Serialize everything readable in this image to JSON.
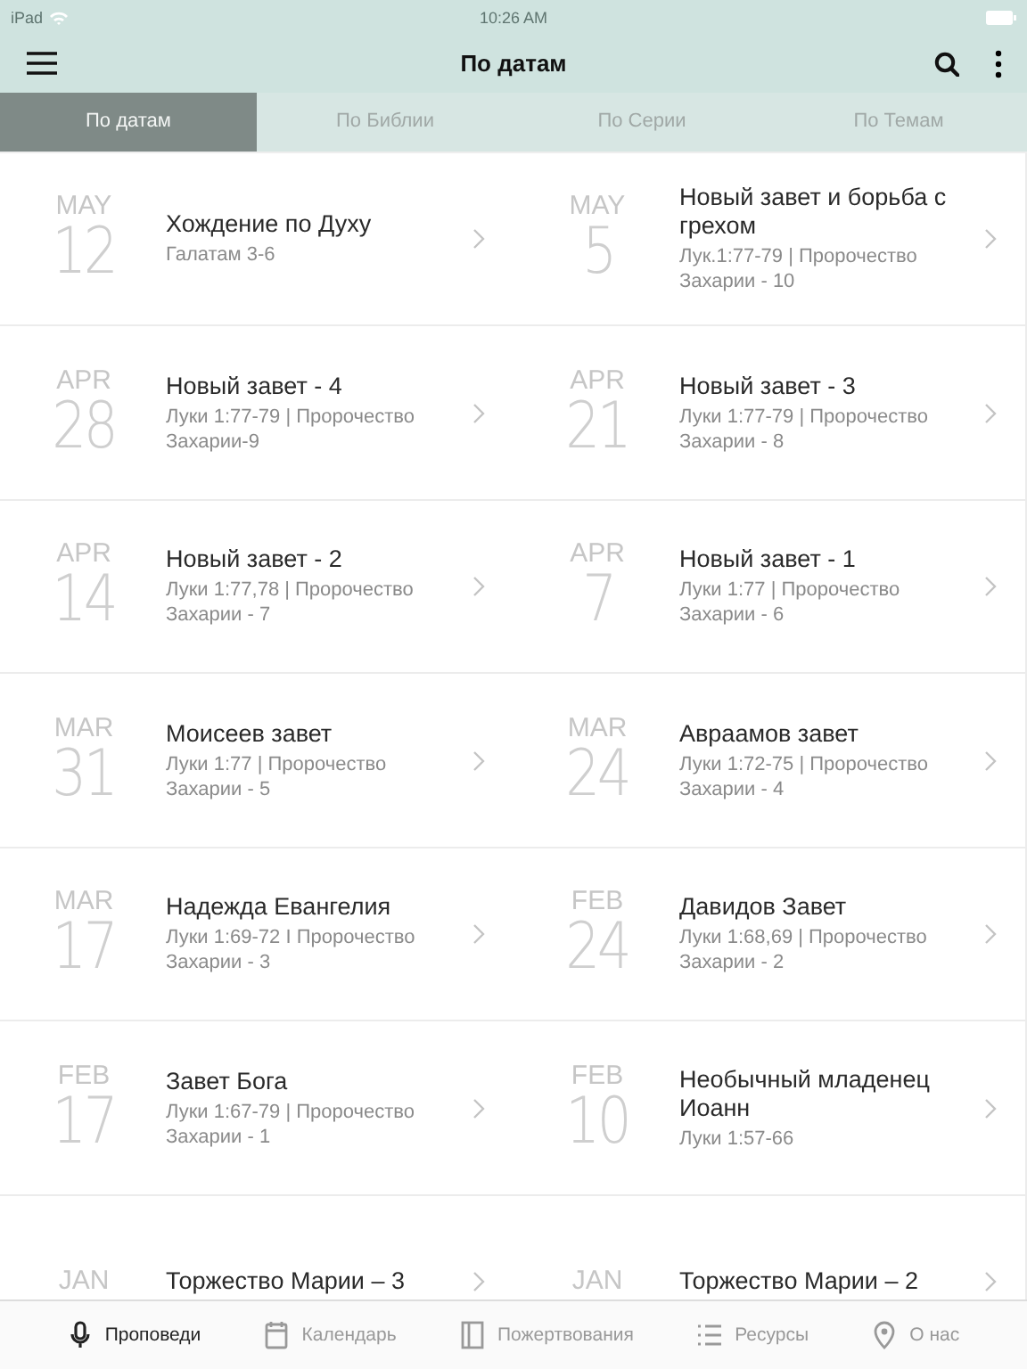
{
  "status_bar": {
    "device": "iPad",
    "time": "10:26 AM"
  },
  "header": {
    "title": "По датам"
  },
  "tabs": [
    {
      "label": "По датам",
      "selected": true
    },
    {
      "label": "По Библии",
      "selected": false
    },
    {
      "label": "По Серии",
      "selected": false
    },
    {
      "label": "По Темам",
      "selected": false
    }
  ],
  "sermons": [
    {
      "month": "MAY",
      "day": "12",
      "title": "Хождение по Духу",
      "reference": "Галатам 3-6"
    },
    {
      "month": "MAY",
      "day": "5",
      "title": "Новый завет и борьба с грехом",
      "reference": "Лук.1:77-79 | Пророчество Захарии - 10"
    },
    {
      "month": "APR",
      "day": "28",
      "title": "Новый завет - 4",
      "reference": "Луки 1:77-79 | Пророчество Захарии-9"
    },
    {
      "month": "APR",
      "day": "21",
      "title": "Новый завет - 3",
      "reference": "Луки 1:77-79 | Пророчество Захарии - 8"
    },
    {
      "month": "APR",
      "day": "14",
      "title": "Новый завет - 2",
      "reference": "Луки 1:77,78 | Пророчество Захарии - 7"
    },
    {
      "month": "APR",
      "day": "7",
      "title": "Новый завет - 1",
      "reference": "Луки 1:77 | Пророчество Захарии - 6"
    },
    {
      "month": "MAR",
      "day": "31",
      "title": "Моисеев завет",
      "reference": "Луки 1:77 | Пророчество Захарии - 5"
    },
    {
      "month": "MAR",
      "day": "24",
      "title": "Авраамов завет",
      "reference": "Луки 1:72-75 | Пророчество Захарии - 4"
    },
    {
      "month": "MAR",
      "day": "17",
      "title": "Надежда Евангелия",
      "reference": "Луки 1:69-72 I Пророчество Захарии - 3"
    },
    {
      "month": "FEB",
      "day": "24",
      "title": "Давидов Завет",
      "reference": "Луки 1:68,69 | Пророчество Захарии - 2"
    },
    {
      "month": "FEB",
      "day": "17",
      "title": "Завет Бога",
      "reference": "Луки 1:67-79 | Пророчество Захарии - 1"
    },
    {
      "month": "FEB",
      "day": "10",
      "title": "Необычный младенец Иоанн",
      "reference": "Луки 1:57-66"
    },
    {
      "month": "JAN",
      "title": "Торжество Марии – 3"
    },
    {
      "month": "JAN",
      "title": "Торжество Марии – 2"
    }
  ],
  "bottom_nav": [
    {
      "kind": "mic",
      "label": "Проповеди",
      "selected": true
    },
    {
      "kind": "calendar",
      "label": "Календарь",
      "selected": false
    },
    {
      "kind": "book",
      "label": "Пожертвования",
      "selected": false
    },
    {
      "kind": "list",
      "label": "Ресурсы",
      "selected": false
    },
    {
      "kind": "pin",
      "label": "О нас",
      "selected": false
    }
  ]
}
